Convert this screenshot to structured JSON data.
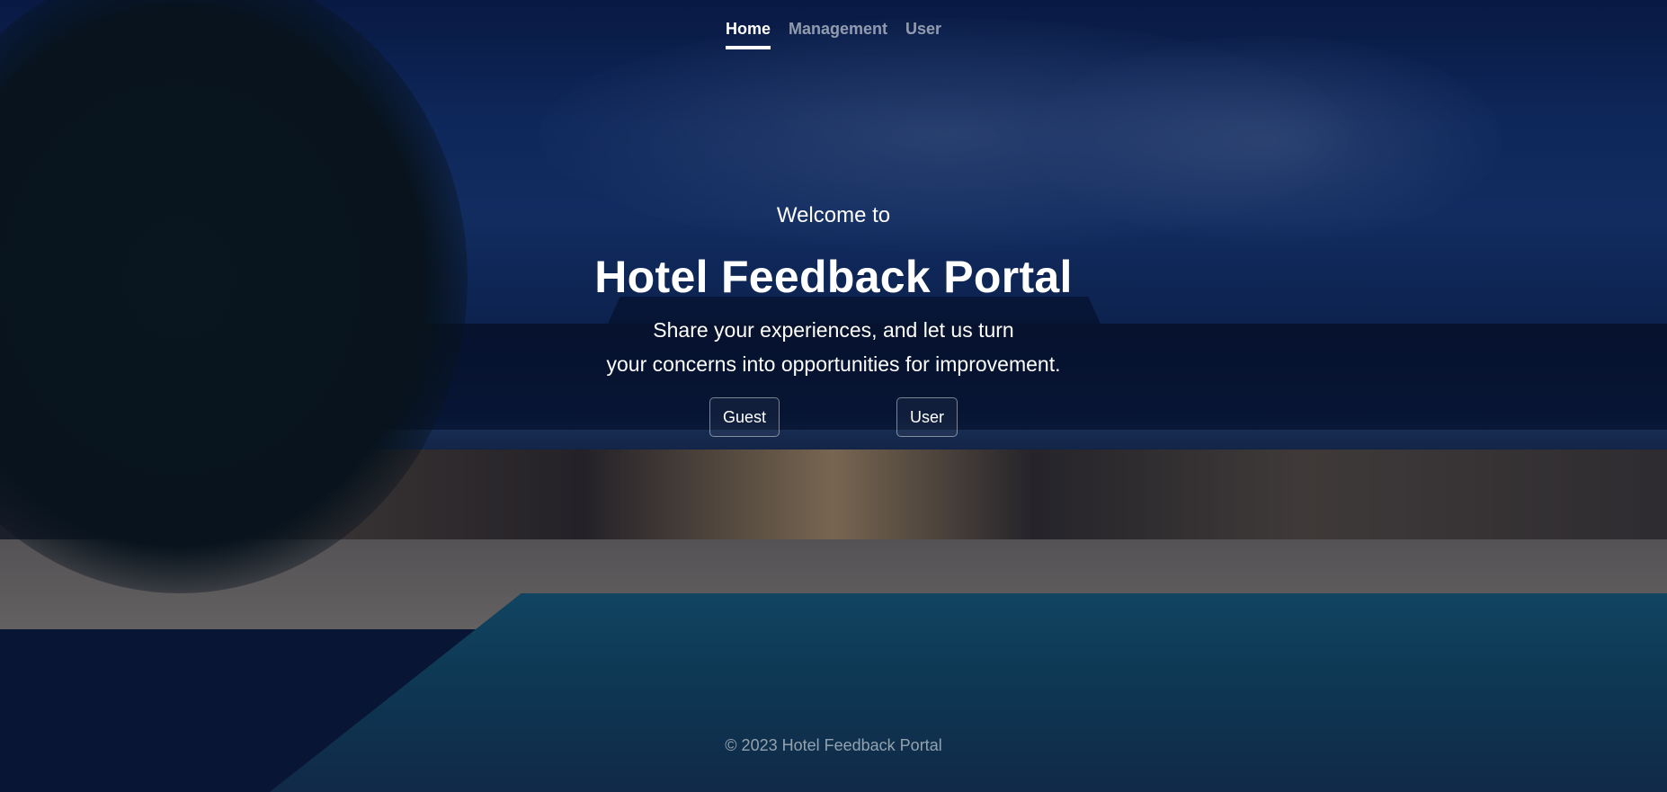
{
  "nav": {
    "items": [
      {
        "label": "Home",
        "active": true
      },
      {
        "label": "Management",
        "active": false
      },
      {
        "label": "User",
        "active": false
      }
    ]
  },
  "hero": {
    "welcome": "Welcome to",
    "title": "Hotel Feedback Portal",
    "tagline_line1": "Share your experiences, and let us turn",
    "tagline_line2": "your concerns into opportunities for improvement.",
    "buttons": {
      "guest_label": "Guest",
      "user_label": "User"
    }
  },
  "footer": {
    "text": "© 2023 Hotel Feedback Portal"
  },
  "colors": {
    "text": "#ffffff",
    "muted_text": "rgba(255,255,255,0.55)",
    "overlay": "#0b1a3a"
  }
}
